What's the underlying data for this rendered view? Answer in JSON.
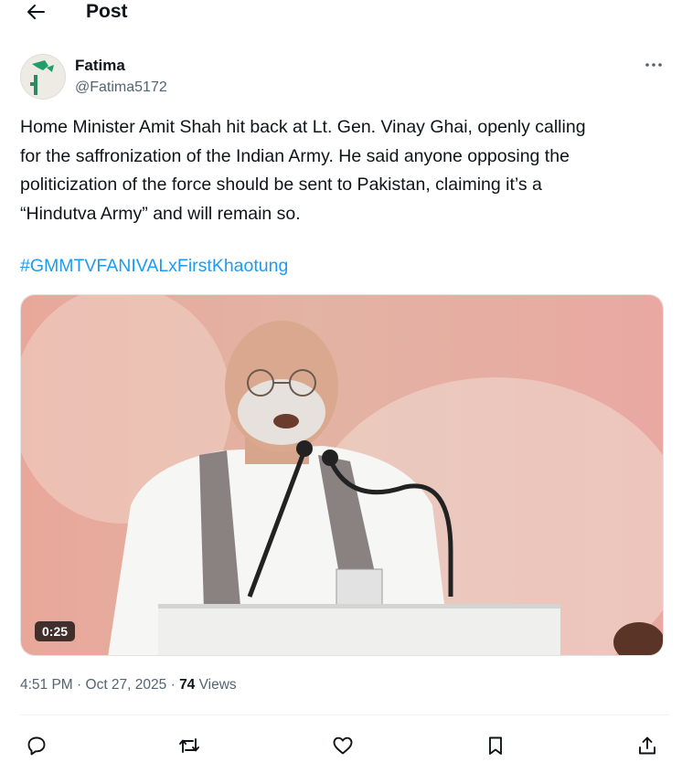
{
  "header": {
    "title": "Post",
    "back_icon": "arrow-left-icon"
  },
  "author": {
    "name": "Fatima",
    "handle": "@Fatima5172",
    "avatar_icon": "avatar-image"
  },
  "post": {
    "text": "Home Minister Amit Shah hit back at Lt. Gen. Vinay Ghai, openly calling\nfor the saffronization of the Indian Army. He said anyone opposing the\npoliticization of the force should be sent to Pakistan, claiming it’s a\n“Hindutva Army” and will remain so.",
    "hashtag": "#GMMTVFANIVALxFirstKhaotung",
    "hashtag_color": "#1d9bf0"
  },
  "media": {
    "type": "video",
    "duration": "0:25"
  },
  "meta": {
    "time": "4:51 PM",
    "sep1": " · ",
    "date": "Oct 27, 2025",
    "sep2": " · ",
    "views_count": "74",
    "views_label": " Views"
  },
  "actions": [
    {
      "name": "reply",
      "icon": "reply-icon"
    },
    {
      "name": "repost",
      "icon": "repost-icon"
    },
    {
      "name": "like",
      "icon": "heart-icon"
    },
    {
      "name": "bookmark",
      "icon": "bookmark-icon"
    },
    {
      "name": "share",
      "icon": "share-icon"
    }
  ],
  "colors": {
    "text": "#0f1419",
    "secondary": "#536471",
    "accent": "#1d9bf0"
  }
}
